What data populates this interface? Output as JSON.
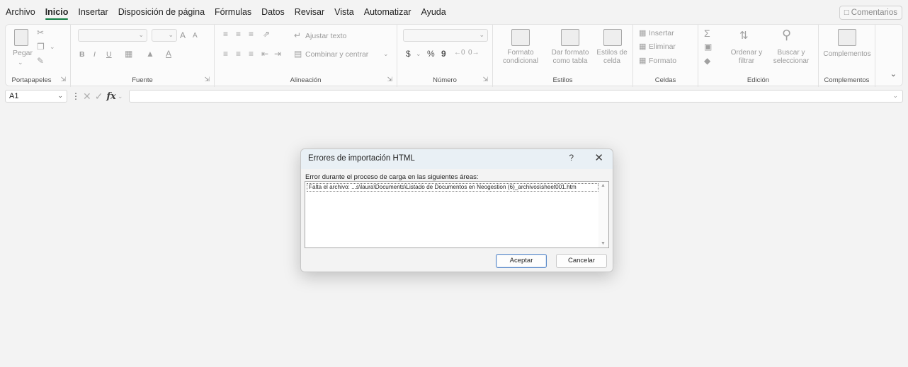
{
  "menu": {
    "tabs": [
      "Archivo",
      "Inicio",
      "Insertar",
      "Disposición de página",
      "Fórmulas",
      "Datos",
      "Revisar",
      "Vista",
      "Automatizar",
      "Ayuda"
    ],
    "active": "Inicio",
    "comments_label": "Comentarios"
  },
  "ribbon": {
    "clipboard": {
      "label": "Portapapeles",
      "paste": "Pegar"
    },
    "font": {
      "label": "Fuente",
      "bold": "B",
      "italic": "I",
      "underline": "U",
      "grow": "A",
      "shrink": "A"
    },
    "alignment": {
      "label": "Alineación",
      "wrap": "Ajustar texto",
      "merge": "Combinar y centrar"
    },
    "number": {
      "label": "Número",
      "currency": "$",
      "percent": "%",
      "comma": "9"
    },
    "styles": {
      "label": "Estilos",
      "conditional": [
        "Formato",
        "condicional"
      ],
      "table": [
        "Dar formato",
        "como tabla"
      ],
      "cell_styles": [
        "Estilos de",
        "celda"
      ]
    },
    "cells": {
      "label": "Celdas",
      "insert": "Insertar",
      "delete": "Eliminar",
      "format": "Formato"
    },
    "editing": {
      "label": "Edición",
      "sort": [
        "Ordenar y",
        "filtrar"
      ],
      "find": [
        "Buscar y",
        "seleccionar"
      ]
    },
    "addins": {
      "label": "Complementos",
      "button": "Complementos"
    }
  },
  "formula_bar": {
    "name_box": "A1",
    "fx": "fx",
    "value": ""
  },
  "dialog": {
    "title": "Errores de importación HTML",
    "help": "?",
    "close": "✕",
    "message": "Error durante el proceso de carga en las siguientes áreas:",
    "items": [
      "Falta el archivo: ...s\\laura\\Documents\\Listado de Documentos en Neogestion (6)_archivos\\sheet001.htm"
    ],
    "ok_label": "Aceptar",
    "cancel_label": "Cancelar"
  },
  "colors": {
    "accent": "#107c41",
    "dialog_title_bg": "#e9f0f5",
    "background": "#f3f3f3"
  }
}
